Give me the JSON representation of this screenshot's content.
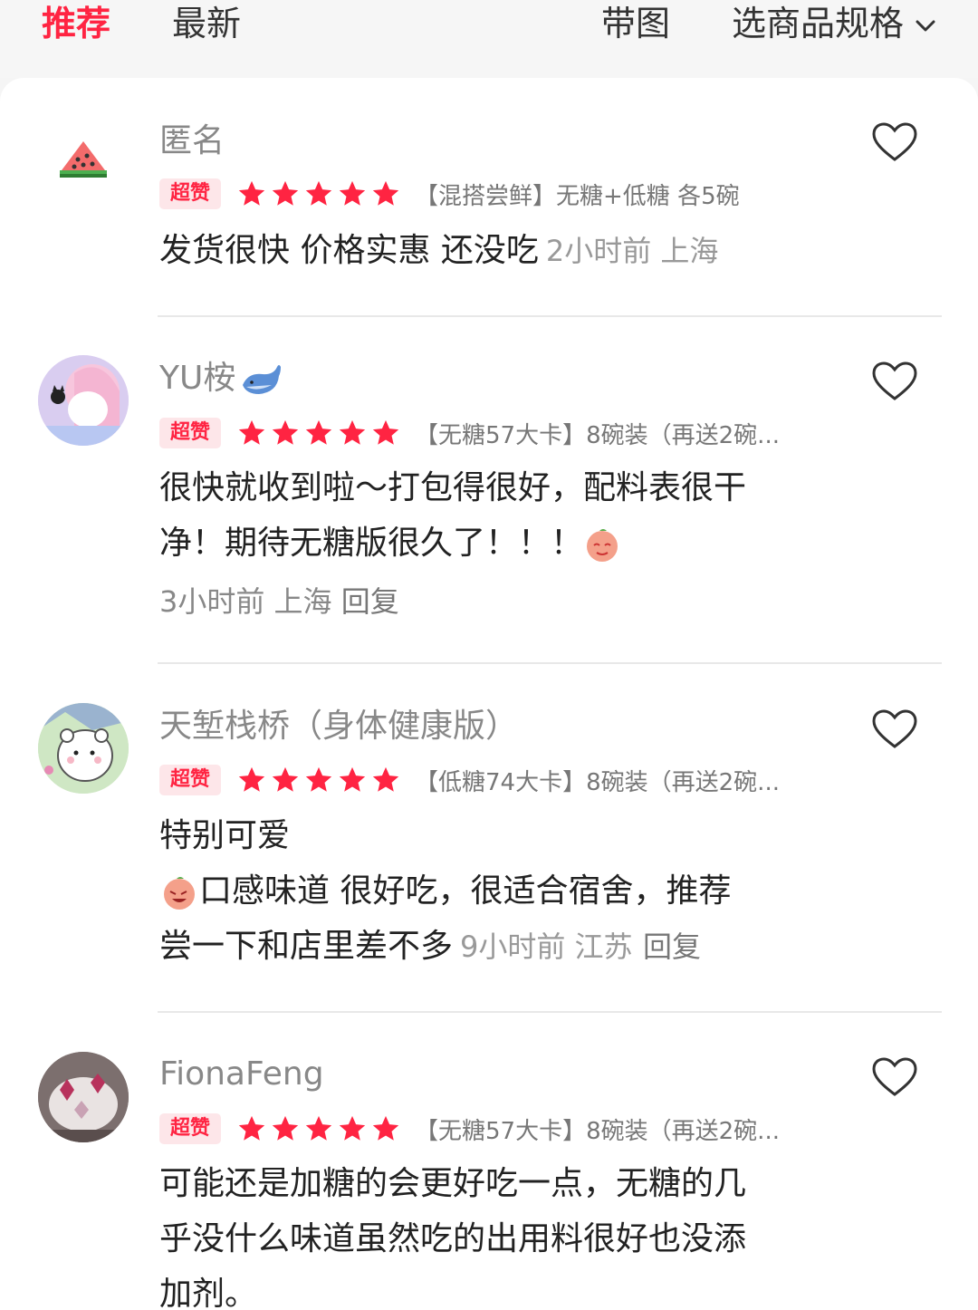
{
  "tabs": {
    "recommended": "推荐",
    "latest": "最新",
    "with_images": "带图",
    "spec_filter": "选商品规格"
  },
  "colors": {
    "accent": "#ff2442",
    "star": "#ff2442",
    "badge_bg": "#fde6e9"
  },
  "reviews": [
    {
      "username": "匿名",
      "avatar": "watermelon-avatar",
      "badge": "超赞",
      "rating": 5,
      "spec": "【混搭尝鲜】无糖+低糖 各5碗",
      "text": "发货很快 价格实惠 还没吃",
      "time_location": "2小时前 上海",
      "reply": ""
    },
    {
      "username": "YU桉",
      "username_emoji": "whale-icon",
      "avatar": "anime-girl-avatar",
      "badge": "超赞",
      "rating": 5,
      "spec": "【无糖57大卡】8碗装（再送2碗...",
      "text_line1": "很快就收到啦～打包得很好，配料表很干",
      "text_line2": "净！期待无糖版很久了！！！",
      "time_location": "3小时前 上海",
      "reply": "回复"
    },
    {
      "username": "天堑栈桥（身体健康版）",
      "avatar": "white-bear-avatar",
      "badge": "超赞",
      "rating": 5,
      "spec": "【低糖74大卡】8碗装（再送2碗...",
      "text_line1": "特别可爱",
      "text_line2": "口感味道 很好吃，很适合宿舍，推荐",
      "text_line3": "尝一下和店里差不多",
      "time_location": "9小时前 江苏",
      "reply": "回复"
    },
    {
      "username": "FionaFeng",
      "avatar": "cake-photo-avatar",
      "badge": "超赞",
      "rating": 5,
      "spec": "【无糖57大卡】8碗装（再送2碗...",
      "text_line1": "可能还是加糖的会更好吃一点，无糖的几",
      "text_line2": "乎没什么味道虽然吃的出用料很好也没添",
      "text_line3": "加剂。"
    }
  ]
}
